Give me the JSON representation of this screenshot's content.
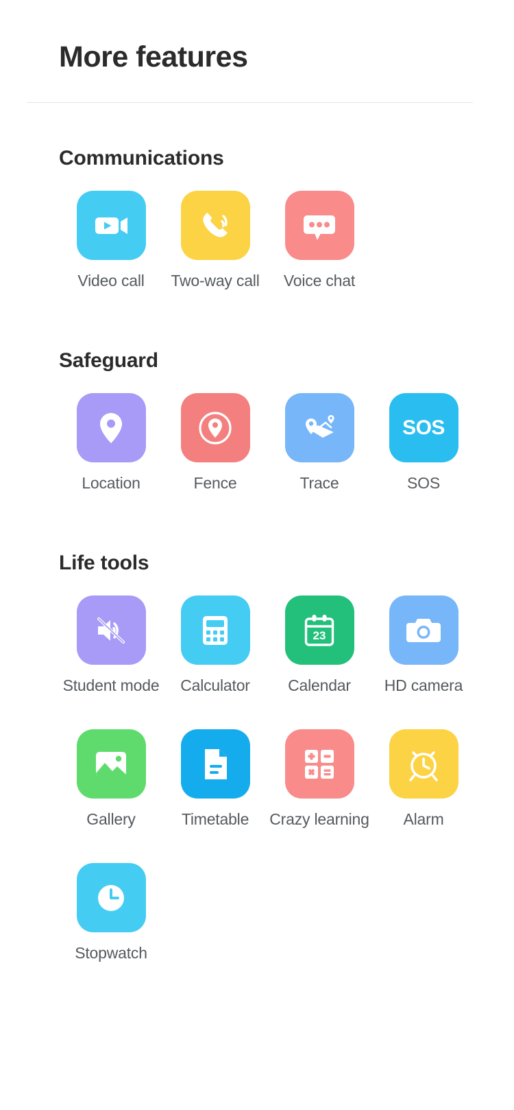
{
  "header": {
    "title": "More features"
  },
  "sections": [
    {
      "id": "communications",
      "title": "Communications",
      "items": [
        {
          "label": "Video call",
          "icon": "video-camera-icon",
          "color": "#45CCF3"
        },
        {
          "label": "Two-way call",
          "icon": "phone-ringing-icon",
          "color": "#FCD344"
        },
        {
          "label": "Voice chat",
          "icon": "chat-bubble-icon",
          "color": "#F98B8B"
        }
      ]
    },
    {
      "id": "safeguard",
      "title": "Safeguard",
      "items": [
        {
          "label": "Location",
          "icon": "map-pin-icon",
          "color": "#A79BF7"
        },
        {
          "label": "Fence",
          "icon": "pin-in-circle-icon",
          "color": "#F47F7F"
        },
        {
          "label": "Trace",
          "icon": "route-map-icon",
          "color": "#77B6F8"
        },
        {
          "label": "SOS",
          "icon": "sos-text-icon",
          "color": "#29BDF0",
          "glyph_text": "SOS"
        }
      ]
    },
    {
      "id": "life-tools",
      "title": "Life tools",
      "items": [
        {
          "label": "Student mode",
          "icon": "mute-speaker-icon",
          "color": "#A79BF7"
        },
        {
          "label": "Calculator",
          "icon": "calculator-icon",
          "color": "#45CCF3"
        },
        {
          "label": "Calendar",
          "icon": "calendar-icon",
          "color": "#23C07B",
          "glyph_text": "23"
        },
        {
          "label": "HD camera",
          "icon": "camera-icon",
          "color": "#77B6F8"
        },
        {
          "label": "Gallery",
          "icon": "photo-image-icon",
          "color": "#5FDB6E"
        },
        {
          "label": "Timetable",
          "icon": "document-icon",
          "color": "#15ACEE"
        },
        {
          "label": "Crazy learning",
          "icon": "math-grid-icon",
          "color": "#F98B8B"
        },
        {
          "label": "Alarm",
          "icon": "alarm-clock-icon",
          "color": "#FCD344"
        },
        {
          "label": "Stopwatch",
          "icon": "stopwatch-icon",
          "color": "#45CCF3"
        }
      ]
    }
  ]
}
